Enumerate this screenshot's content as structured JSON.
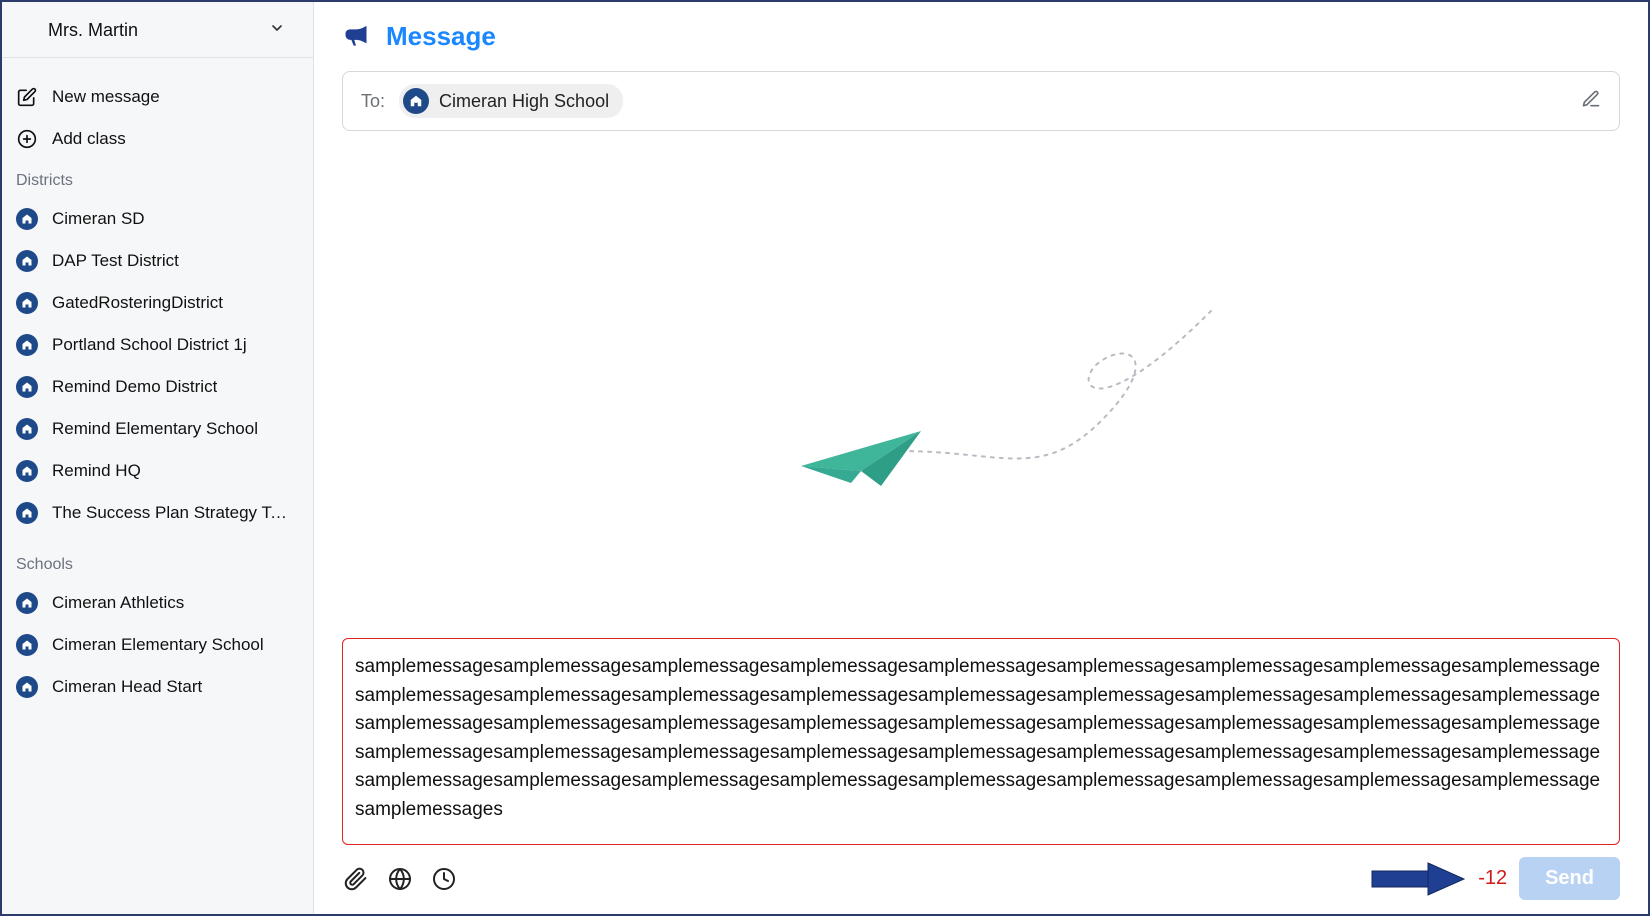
{
  "sidebar": {
    "user_name": "Mrs. Martin",
    "new_message_label": "New message",
    "add_class_label": "Add class",
    "districts_heading": "Districts",
    "districts": [
      "Cimeran SD",
      "DAP Test District",
      "GatedRosteringDistrict",
      "Portland School District 1j",
      "Remind Demo District",
      "Remind Elementary School",
      "Remind HQ",
      "The Success Plan Strategy Te..."
    ],
    "schools_heading": "Schools",
    "schools": [
      "Cimeran Athletics",
      "Cimeran Elementary School",
      "Cimeran Head Start"
    ]
  },
  "compose": {
    "page_title": "Message",
    "to_label": "To:",
    "recipient": "Cimeran High School",
    "message_value": "samplemessagesamplemessagesamplemessagesamplemessagesamplemessagesamplemessagesamplemessagesamplemessagesamplemessagesamplemessagesamplemessagesamplemessagesamplemessagesamplemessagesamplemessagesamplemessagesamplemessagesamplemessagesamplemessagesamplemessagesamplemessagesamplemessagesamplemessagesamplemessagesamplemessagesamplemessagesamplemessagesamplemessagesamplemessagesamplemessagesamplemessagesamplemessagesamplemessagesamplemessagesamplemessagesamplemessagesamplemessagesamplemessagesamplemessagesamplemessagesamplemessagesamplemessagesamplemessagesamplemessagesamplemessagesamplemessages",
    "char_counter": "-12",
    "send_label": "Send"
  },
  "colors": {
    "accent": "#1a87ff",
    "error": "#e02424",
    "arrow": "#1f3f93"
  }
}
